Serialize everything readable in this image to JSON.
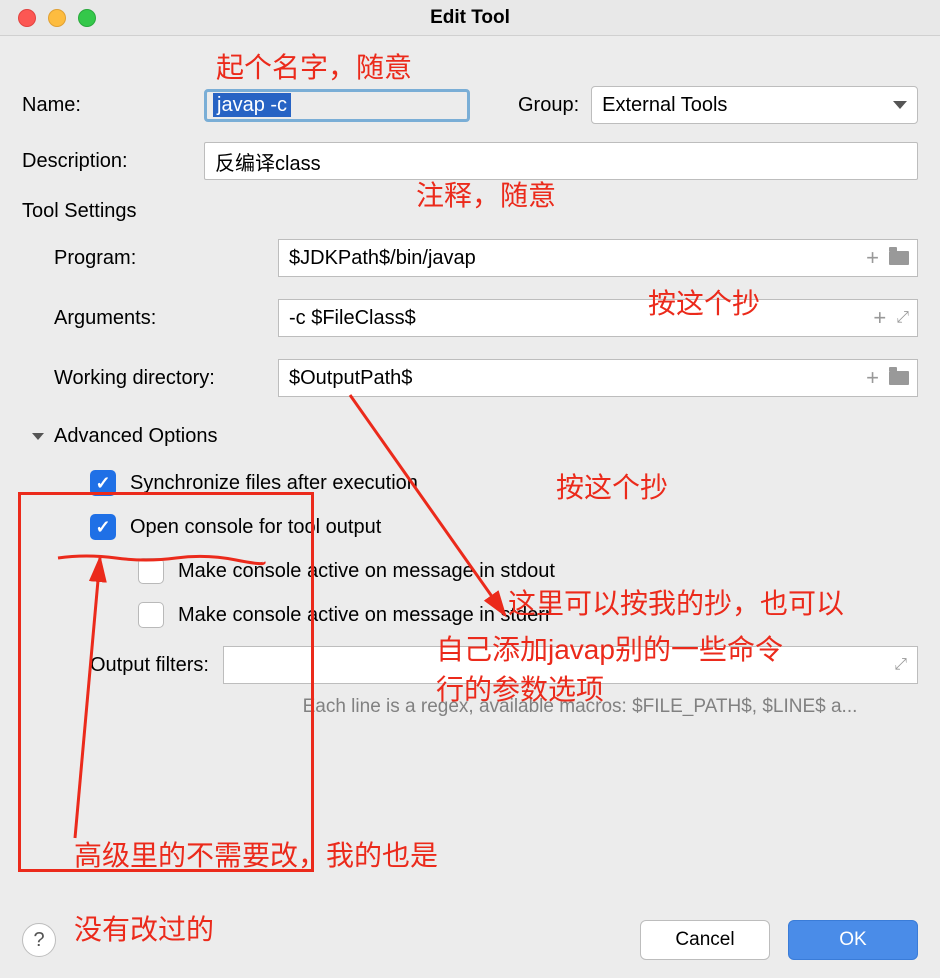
{
  "window": {
    "title": "Edit Tool"
  },
  "fields": {
    "name_label": "Name:",
    "name_value": "javap -c",
    "group_label": "Group:",
    "group_value": "External Tools",
    "description_label": "Description:",
    "description_value": "反编译class"
  },
  "tool_settings": {
    "heading": "Tool Settings",
    "program_label": "Program:",
    "program_value": "$JDKPath$/bin/javap",
    "arguments_label": "Arguments:",
    "arguments_value": "-c $FileClass$",
    "workdir_label": "Working directory:",
    "workdir_value": "$OutputPath$"
  },
  "advanced": {
    "heading": "Advanced Options",
    "sync_label": "Synchronize files after execution",
    "open_console_label": "Open console for tool output",
    "stdout_label": "Make console active on message in stdout",
    "stderr_label": "Make console active on message in stderr",
    "output_filters_label": "Output filters:",
    "hint": "Each line is a regex, available macros: $FILE_PATH$, $LINE$ a..."
  },
  "footer": {
    "cancel": "Cancel",
    "ok": "OK"
  },
  "annotations": {
    "a1": "起个名字，随意",
    "a2": "注释，随意",
    "a3": "按这个抄",
    "a4": "按这个抄",
    "a5_line1": "这里可以按我的抄，也可以",
    "a5_line2": "自己添加javap别的一些命令",
    "a5_line3": "行的参数选项",
    "a6_line1": "高级里的不需要改，我的也是",
    "a6_line2": "没有改过的"
  }
}
